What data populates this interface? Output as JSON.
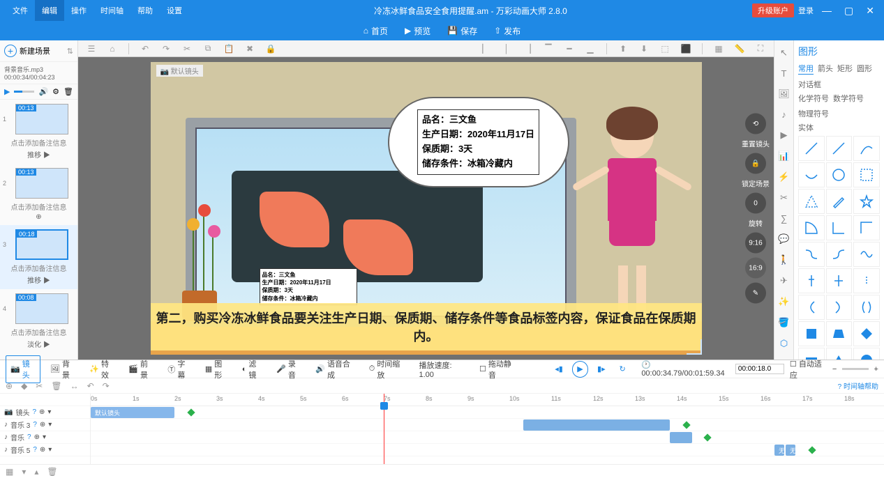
{
  "app": {
    "title": "冷冻冰鲜食品安全食用提醒.am - 万彩动画大师 2.8.0",
    "upgrade": "升级账户",
    "login": "登录"
  },
  "menu": {
    "items": [
      "文件",
      "编辑",
      "操作",
      "时间轴",
      "帮助",
      "设置"
    ],
    "activeIndex": 1
  },
  "sub": {
    "home": "首页",
    "preview": "预览",
    "save": "保存",
    "publish": "发布"
  },
  "left": {
    "newScene": "新建场景",
    "bgm": "背景音乐.mp3 00:00:34/00:04:23",
    "scenes": [
      {
        "t": "00:13",
        "cap": "点击添加备注信息",
        "tr": "推移 ▶"
      },
      {
        "t": "00:13",
        "cap": "点击添加备注信息",
        "tr": ""
      },
      {
        "t": "00:18",
        "cap": "点击添加备注信息",
        "tr": "推移 ▶",
        "sel": true
      },
      {
        "t": "00:08",
        "cap": "点击添加备注信息",
        "tr": "淡化 ▶"
      }
    ]
  },
  "stage": {
    "cameraLabel": "默认镜头",
    "labelSmall": "品名：三文鱼\n生产日期：2020年11月17日\n保质期：3天\n储存条件：冰箱冷藏内",
    "bubble": {
      "l1": "品名：三文鱼",
      "l2": "生产日期：2020年11月17日",
      "l3": "保质期：3天",
      "l4": "储存条件：冰箱冷藏内"
    },
    "subtitle": "第二，购买冷冻冰鲜食品要关注生产日期、保质期、储存条件等食品标签内容，保证食品在保质期内。",
    "right": {
      "reset": "重置镜头",
      "lock": "锁定场景",
      "zero": "0",
      "rot": "旋转",
      "ratio": "9:16"
    }
  },
  "rpanel": {
    "title": "图形",
    "tabs": [
      "常用",
      "箭头",
      "矩形",
      "圆形",
      "对话框",
      "化学符号",
      "数学符号",
      "物理符号",
      "实体"
    ],
    "active": 0
  },
  "bottom": {
    "tabs": {
      "camera": "镜头",
      "bg": "背景",
      "fx": "特效",
      "scene": "前景",
      "caption": "字幕",
      "grid": "图形",
      "filter": "滤镜",
      "rec": "录音",
      "tts": "语音合成",
      "tscale": "时间缩放",
      "speed": "播放速度: 1.00",
      "mute": "拖动静音"
    },
    "time": "00:00:34.79/00:01:59.34",
    "timebox": "00:00:18.0",
    "autofit": "自动适应",
    "help": "时间轴帮助",
    "tracks": {
      "cam": "镜头",
      "a3": "音乐 3",
      "a": "音乐",
      "a5": "音乐 5"
    },
    "camclip": "默认镜头",
    "wu": "无"
  }
}
